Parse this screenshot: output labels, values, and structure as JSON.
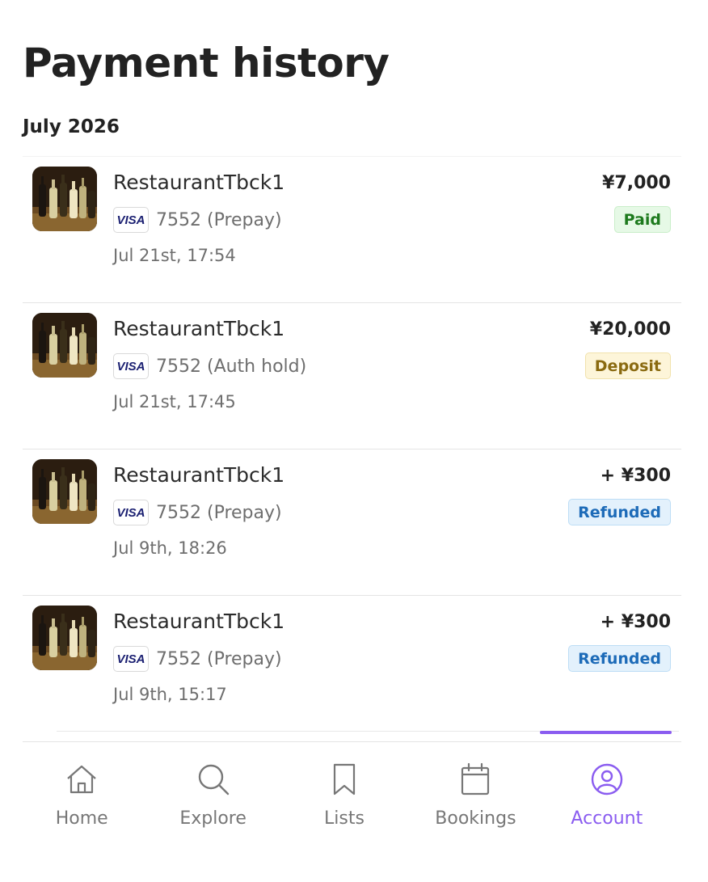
{
  "page": {
    "title": "Payment history"
  },
  "month_group": {
    "heading": "July 2026"
  },
  "payments": [
    {
      "merchant": "RestaurantTbck1",
      "card_brand": "VISA",
      "card_desc": "7552 (Prepay)",
      "datetime": "Jul 21st, 17:54",
      "amount": "¥7,000",
      "status": "Paid",
      "status_type": "paid"
    },
    {
      "merchant": "RestaurantTbck1",
      "card_brand": "VISA",
      "card_desc": "7552 (Auth hold)",
      "datetime": "Jul 21st, 17:45",
      "amount": "¥20,000",
      "status": "Deposit",
      "status_type": "deposit"
    },
    {
      "merchant": "RestaurantTbck1",
      "card_brand": "VISA",
      "card_desc": "7552 (Prepay)",
      "datetime": "Jul 9th, 18:26",
      "amount": "+ ¥300",
      "status": "Refunded",
      "status_type": "refunded"
    },
    {
      "merchant": "RestaurantTbck1",
      "card_brand": "VISA",
      "card_desc": "7552 (Prepay)",
      "datetime": "Jul 9th, 15:17",
      "amount": "+ ¥300",
      "status": "Refunded",
      "status_type": "refunded"
    }
  ],
  "bottom_nav": {
    "items": [
      {
        "label": "Home",
        "icon": "home-icon",
        "active": false
      },
      {
        "label": "Explore",
        "icon": "search-icon",
        "active": false
      },
      {
        "label": "Lists",
        "icon": "bookmark-icon",
        "active": false
      },
      {
        "label": "Bookings",
        "icon": "calendar-icon",
        "active": false
      },
      {
        "label": "Account",
        "icon": "account-icon",
        "active": true
      }
    ]
  },
  "colors": {
    "accent": "#8a5cf0",
    "paid_text": "#1d7a1d",
    "paid_bg": "#e6f9e6",
    "deposit_text": "#8a6a10",
    "deposit_bg": "#fdf5d9",
    "refunded_text": "#1d6bb8",
    "refunded_bg": "#e3f1fc",
    "visa_blue": "#1a1f71"
  }
}
